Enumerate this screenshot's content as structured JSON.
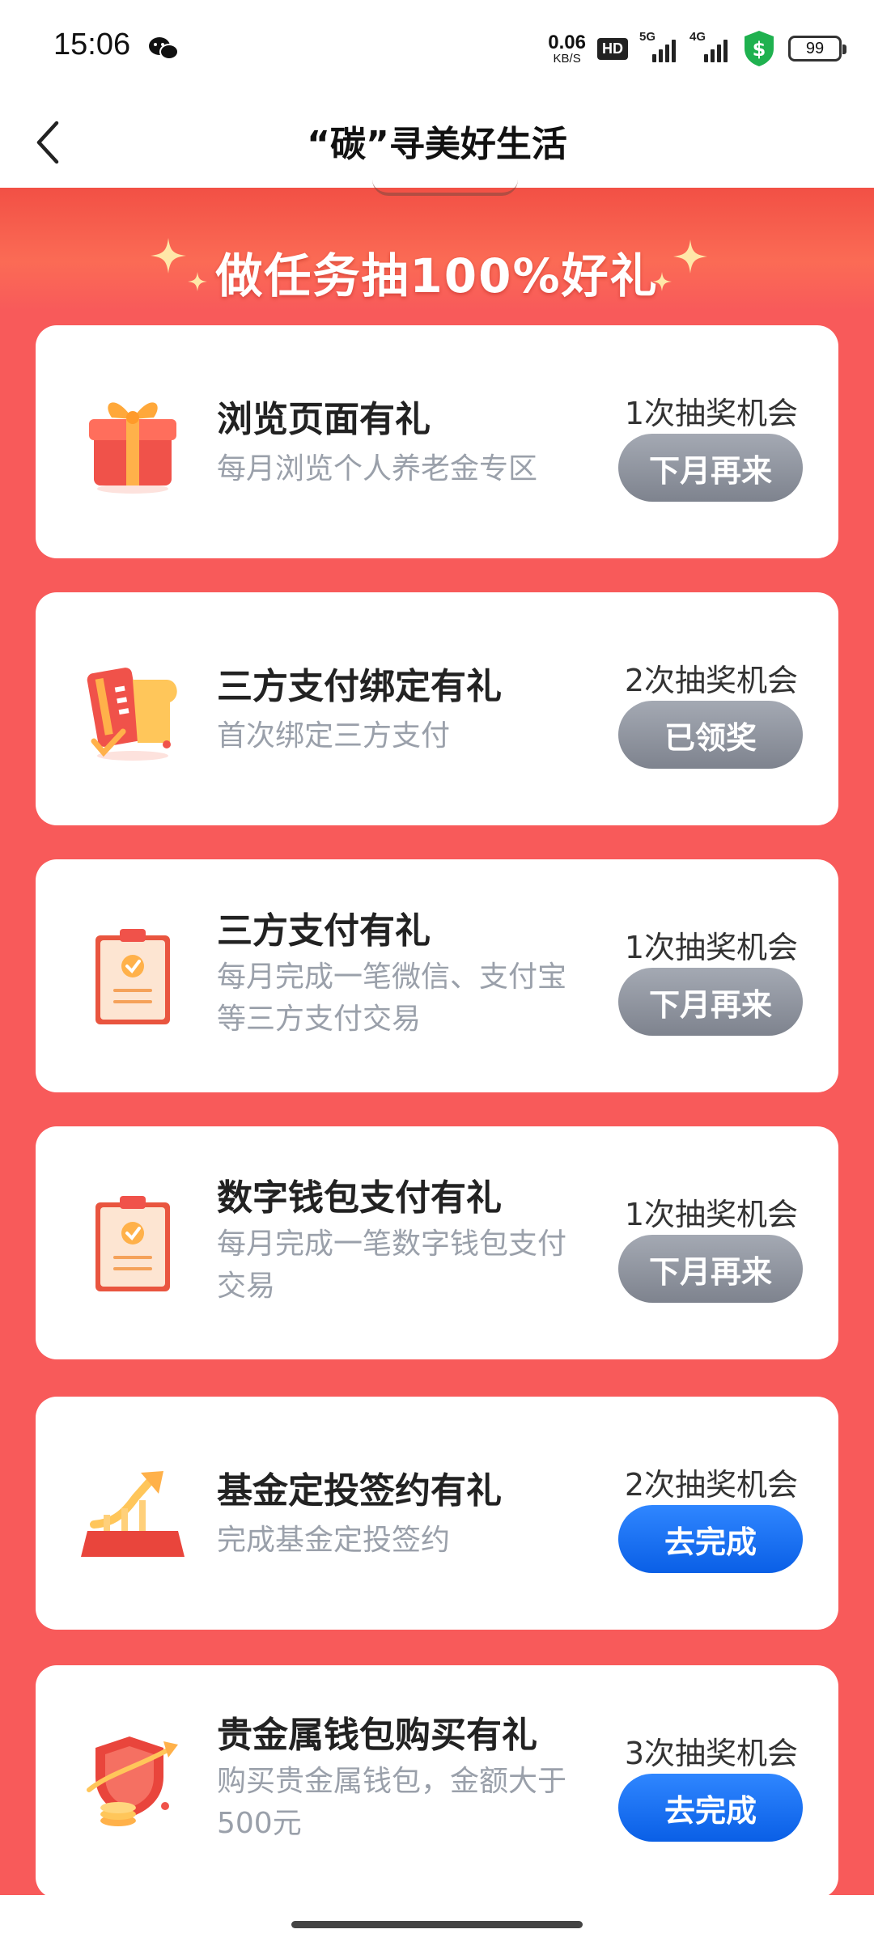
{
  "status_bar": {
    "time": "15:06",
    "net_speed_value": "0.06",
    "net_speed_unit": "KB/S",
    "hd_label": "HD",
    "signal_5g_label": "5G",
    "signal_4g_label": "4G",
    "battery": "99"
  },
  "nav": {
    "title": "“碳”寻美好生活"
  },
  "banner": {
    "text": "做任务抽100%好礼"
  },
  "colors": {
    "page_red": "#f85a5a",
    "button_grey": "#8a8f99",
    "button_blue": "#1670f5"
  },
  "tasks": [
    {
      "title": "浏览页面有礼",
      "desc": "每月浏览个人养老金专区",
      "chance": "1次抽奖机会",
      "button": "下月再来",
      "button_state": "disabled",
      "icon": "gift-box-icon"
    },
    {
      "title": "三方支付绑定有礼",
      "desc": "首次绑定三方支付",
      "chance": "2次抽奖机会",
      "button": "已领奖",
      "button_state": "disabled",
      "icon": "card-bind-icon"
    },
    {
      "title": "三方支付有礼",
      "desc": "每月完成一笔微信、支付宝等三方支付交易",
      "chance": "1次抽奖机会",
      "button": "下月再来",
      "button_state": "disabled",
      "icon": "clipboard-icon"
    },
    {
      "title": "数字钱包支付有礼",
      "desc": "每月完成一笔数字钱包支付交易",
      "chance": "1次抽奖机会",
      "button": "下月再来",
      "button_state": "disabled",
      "icon": "clipboard-icon"
    },
    {
      "title": "基金定投签约有礼",
      "desc": "完成基金定投签约",
      "chance": "2次抽奖机会",
      "button": "去完成",
      "button_state": "active",
      "icon": "growth-arrow-icon"
    },
    {
      "title": "贵金属钱包购买有礼",
      "desc": "购买贵金属钱包，金额大于500元",
      "chance": "3次抽奖机会",
      "button": "去完成",
      "button_state": "active",
      "icon": "shield-coins-icon"
    }
  ]
}
